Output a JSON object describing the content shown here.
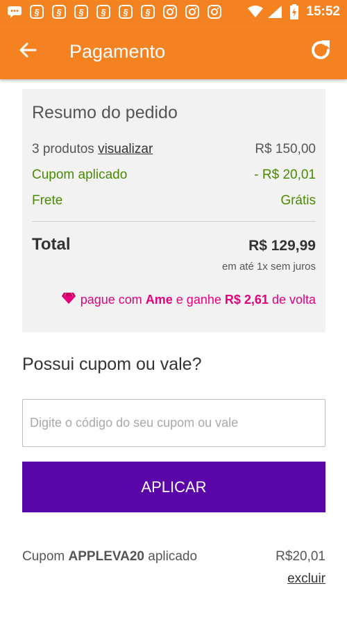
{
  "status_bar": {
    "time": "15:52",
    "icons": [
      "message-icon",
      "app-icon",
      "app-icon",
      "app-icon",
      "app-icon",
      "app-icon",
      "app-icon",
      "instagram-icon",
      "instagram-icon",
      "instagram-icon",
      "wifi-icon",
      "signal-icon",
      "battery-charging-icon"
    ]
  },
  "app_bar": {
    "title": "Pagamento",
    "back_icon": "arrow-left-icon",
    "refresh_icon": "refresh-icon",
    "color": "#f58220"
  },
  "summary": {
    "title": "Resumo do pedido",
    "products_text": "3 produtos",
    "products_link": "visualizar",
    "products_value": "R$ 150,00",
    "coupon_label": "Cupom aplicado",
    "coupon_value": "- R$ 20,01",
    "shipping_label": "Frete",
    "shipping_value": "Grátis",
    "total_label": "Total",
    "total_value": "R$ 129,99",
    "installments": "em até 1x sem juros",
    "ame_text_1": "pague com",
    "ame_brand": "Ame",
    "ame_text_2": "e ganhe",
    "ame_cashback": "R$ 2,61",
    "ame_text_3": "de volta"
  },
  "coupon": {
    "title": "Possui cupom ou vale?",
    "placeholder": "Digite o código do seu cupom ou vale",
    "value": "",
    "button_label": "APLICAR",
    "button_color": "#5a06a9"
  },
  "applied": {
    "prefix": "Cupom",
    "code": "APPLEVA20",
    "suffix": "aplicado",
    "value": "R$20,01",
    "remove_label": "excluir"
  },
  "colors": {
    "accent": "#f58220",
    "green": "#4a8a00",
    "ame_pink": "#e5007e",
    "purple": "#5a06a9"
  }
}
